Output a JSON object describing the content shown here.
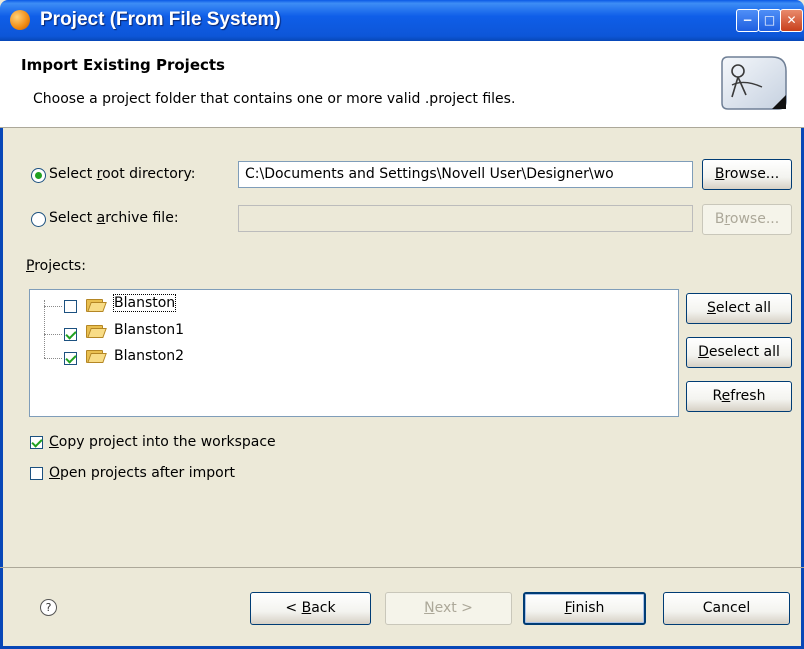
{
  "window": {
    "title": "Project (From File System)",
    "controls": {
      "minimize": "−",
      "maximize": "□",
      "close": "✕"
    }
  },
  "banner": {
    "title": "Import Existing Projects",
    "description": "Choose a project folder that contains one or more valid .project files."
  },
  "source": {
    "root_radio": {
      "prefix": "Select ",
      "accel": "r",
      "suffix": "oot directory:",
      "selected": true
    },
    "root_value": "C:\\Documents and Settings\\Novell User\\Designer\\wo",
    "root_browse": {
      "prefix": "",
      "accel": "B",
      "suffix": "rowse..."
    },
    "archive_radio": {
      "prefix": "Select ",
      "accel": "a",
      "suffix": "rchive file:",
      "selected": false
    },
    "archive_value": "",
    "archive_browse": {
      "prefix": "B",
      "accel": "r",
      "suffix": "owse..."
    }
  },
  "projects": {
    "label": {
      "prefix": "",
      "accel": "P",
      "suffix": "rojects:"
    },
    "items": [
      {
        "name": "Blanston",
        "checked": false
      },
      {
        "name": "Blanston1",
        "checked": true
      },
      {
        "name": "Blanston2",
        "checked": true
      }
    ],
    "select_all": {
      "prefix": "",
      "accel": "S",
      "suffix": "elect all"
    },
    "deselect_all": {
      "prefix": "",
      "accel": "D",
      "suffix": "eselect all"
    },
    "refresh": {
      "prefix": "R",
      "accel": "e",
      "suffix": "fresh"
    }
  },
  "options": {
    "copy": {
      "prefix": "",
      "accel": "C",
      "suffix": "opy project into the workspace",
      "checked": true
    },
    "open": {
      "prefix": "",
      "accel": "O",
      "suffix": "pen projects after import",
      "checked": false
    }
  },
  "footer": {
    "help_icon": "?",
    "back": {
      "prefix": "< ",
      "accel": "B",
      "suffix": "ack"
    },
    "next": {
      "prefix": "",
      "accel": "N",
      "suffix": "ext >"
    },
    "finish": {
      "prefix": "",
      "accel": "F",
      "suffix": "inish"
    },
    "cancel": "Cancel"
  }
}
